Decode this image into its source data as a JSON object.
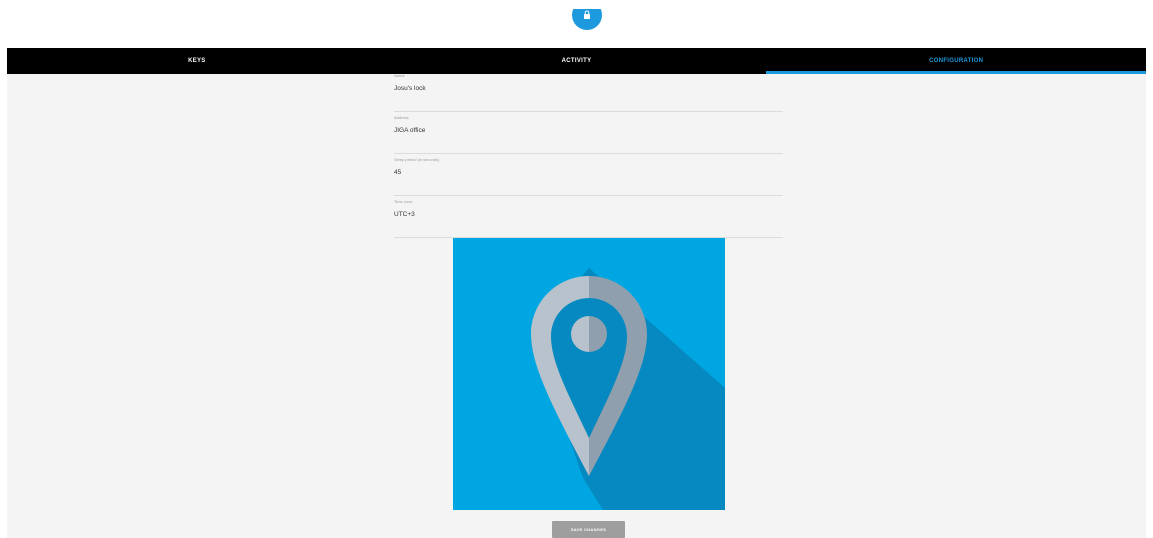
{
  "tabs": [
    {
      "label": "KEYS",
      "active": false
    },
    {
      "label": "ACTIVITY",
      "active": false
    },
    {
      "label": "CONFIGURATION",
      "active": true
    }
  ],
  "form": {
    "fields": [
      {
        "label": "Name",
        "value": "Josu's lock"
      },
      {
        "label": "Address",
        "value": "JIGA office"
      },
      {
        "label": "Sleep period (in seconds)",
        "value": "45"
      },
      {
        "label": "Time zone",
        "value": "UTC+3"
      }
    ],
    "save_label": "SAVE CHANGES"
  },
  "icons": {
    "top_button": "lock-icon",
    "image": "map-marker-icon"
  },
  "colors": {
    "accent": "#1d9ade",
    "tabbar": "#000000",
    "image_bg": "#00a6e1",
    "save_button": "#9e9e9e"
  }
}
